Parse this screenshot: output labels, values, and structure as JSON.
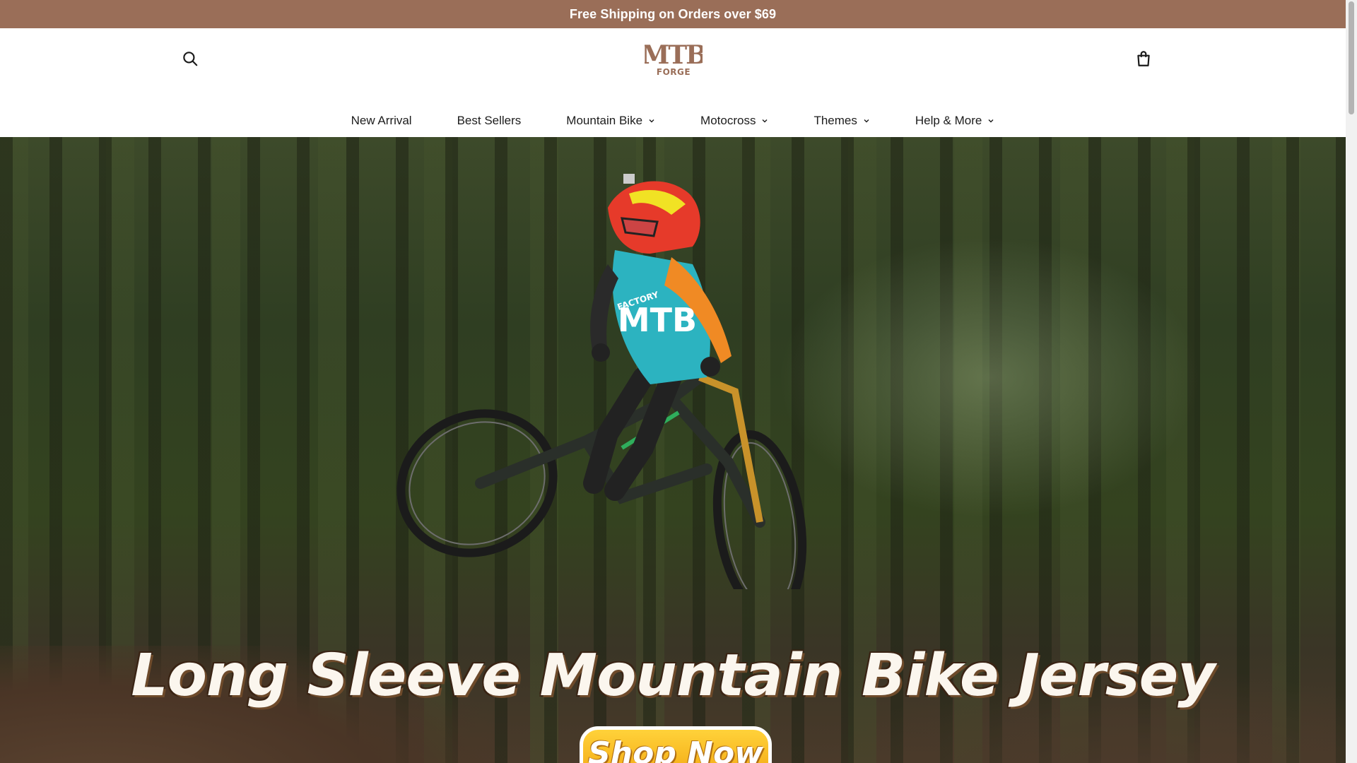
{
  "announcement": {
    "text": "Free Shipping on Orders over $69"
  },
  "header": {
    "logo_top": "MTB",
    "logo_bottom": "FORGE",
    "brand_color": "#9a6e58"
  },
  "nav": {
    "items": [
      {
        "label": "New Arrival",
        "dropdown": false
      },
      {
        "label": "Best Sellers",
        "dropdown": false
      },
      {
        "label": "Mountain Bike",
        "dropdown": true
      },
      {
        "label": "Motocross",
        "dropdown": true
      },
      {
        "label": "Themes",
        "dropdown": true
      },
      {
        "label": "Help & More",
        "dropdown": true
      }
    ]
  },
  "hero": {
    "title": "Long Sleeve Mountain Bike Jersey",
    "cta": "Shop Now",
    "jersey_text": "MTB",
    "jersey_sub": "FACTORY"
  },
  "icons": {
    "search": "search-icon",
    "cart": "shopping-bag-icon",
    "chevron": "chevron-down-icon"
  }
}
